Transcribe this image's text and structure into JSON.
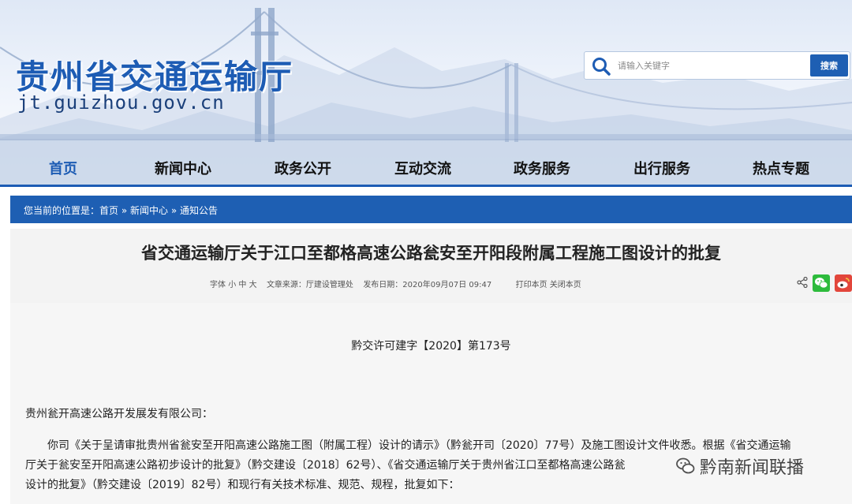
{
  "header": {
    "site_title": "贵州省交通运输厅",
    "site_domain": "jt.guizhou.gov.cn"
  },
  "search": {
    "placeholder": "请输入关键字",
    "button_label": "搜索"
  },
  "nav": {
    "items": [
      {
        "label": "首页",
        "active": true
      },
      {
        "label": "新闻中心"
      },
      {
        "label": "政务公开"
      },
      {
        "label": "互动交流"
      },
      {
        "label": "政务服务"
      },
      {
        "label": "出行服务"
      },
      {
        "label": "热点专题"
      }
    ]
  },
  "breadcrumb": {
    "prefix": "您当前的位置是：",
    "items": [
      "首页",
      "新闻中心",
      "通知公告"
    ],
    "separator": " » "
  },
  "article": {
    "title": "省交通运输厅关于江口至都格高速公路瓮安至开阳段附属工程施工图设计的批复",
    "meta": {
      "font_label": "字体",
      "font_small": "小",
      "font_medium": "中",
      "font_large": "大",
      "source": "文章来源：厅建设管理处",
      "date": "发布日期：2020年09月07日 09:47",
      "print": "打印本页",
      "close": "关闭本页"
    },
    "doc_number": "黔交许可建字【2020】第173号",
    "recipient": "贵州瓮开高速公路开发展发有限公司：",
    "paragraph_lines": [
      "你司《关于呈请审批贵州省瓮安至开阳高速公路施工图（附属工程）设计的请示》（黔瓮开司〔2020〕77号）及施工图设计文件收悉。根据《省交通运输",
      "厅关于瓮安至开阳高速公路初步设计的批复》（黔交建设〔2018〕62号）、《省交通运输厅关于贵州省江口至都格高速公路瓮",
      "设计的批复》（黔交建设〔2019〕82号）和现行有关技术标准、规范、规程，批复如下："
    ]
  },
  "watermark": {
    "text": "黔南新闻联播"
  },
  "colors": {
    "brand_blue": "#1d5cb4",
    "breadcrumb_bg": "#1e5fb3",
    "wechat_green": "#2dbb3c",
    "weibo_red": "#e2463b"
  }
}
